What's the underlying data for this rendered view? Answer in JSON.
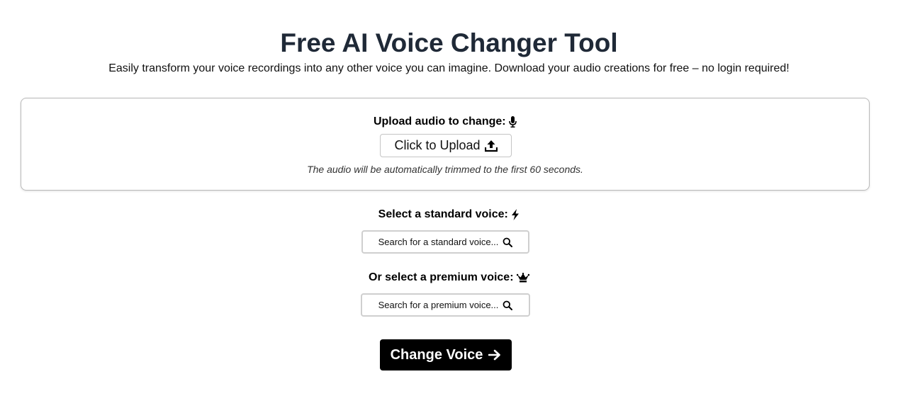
{
  "header": {
    "title": "Free AI Voice Changer Tool",
    "subtitle": "Easily transform your voice recordings into any other voice you can imagine. Download your audio creations for free – no login required!"
  },
  "upload": {
    "label": "Upload audio to change:",
    "label_icon": "microphone-icon",
    "button_label": "Click to Upload",
    "button_icon": "upload-icon",
    "note": "The audio will be automatically trimmed to the first 60 seconds."
  },
  "standard_voice": {
    "label": "Select a standard voice:",
    "label_icon": "lightning-icon",
    "placeholder": "Search for a standard voice...",
    "search_icon": "search-icon"
  },
  "premium_voice": {
    "label": "Or select a premium voice:",
    "label_icon": "crown-icon",
    "placeholder": "Search for a premium voice...",
    "search_icon": "search-icon"
  },
  "action": {
    "button_label": "Change Voice",
    "button_icon": "arrow-right-icon"
  },
  "colors": {
    "title": "#1f2937",
    "primary_button_bg": "#000000",
    "primary_button_text": "#ffffff",
    "border": "#c4c4c4"
  }
}
